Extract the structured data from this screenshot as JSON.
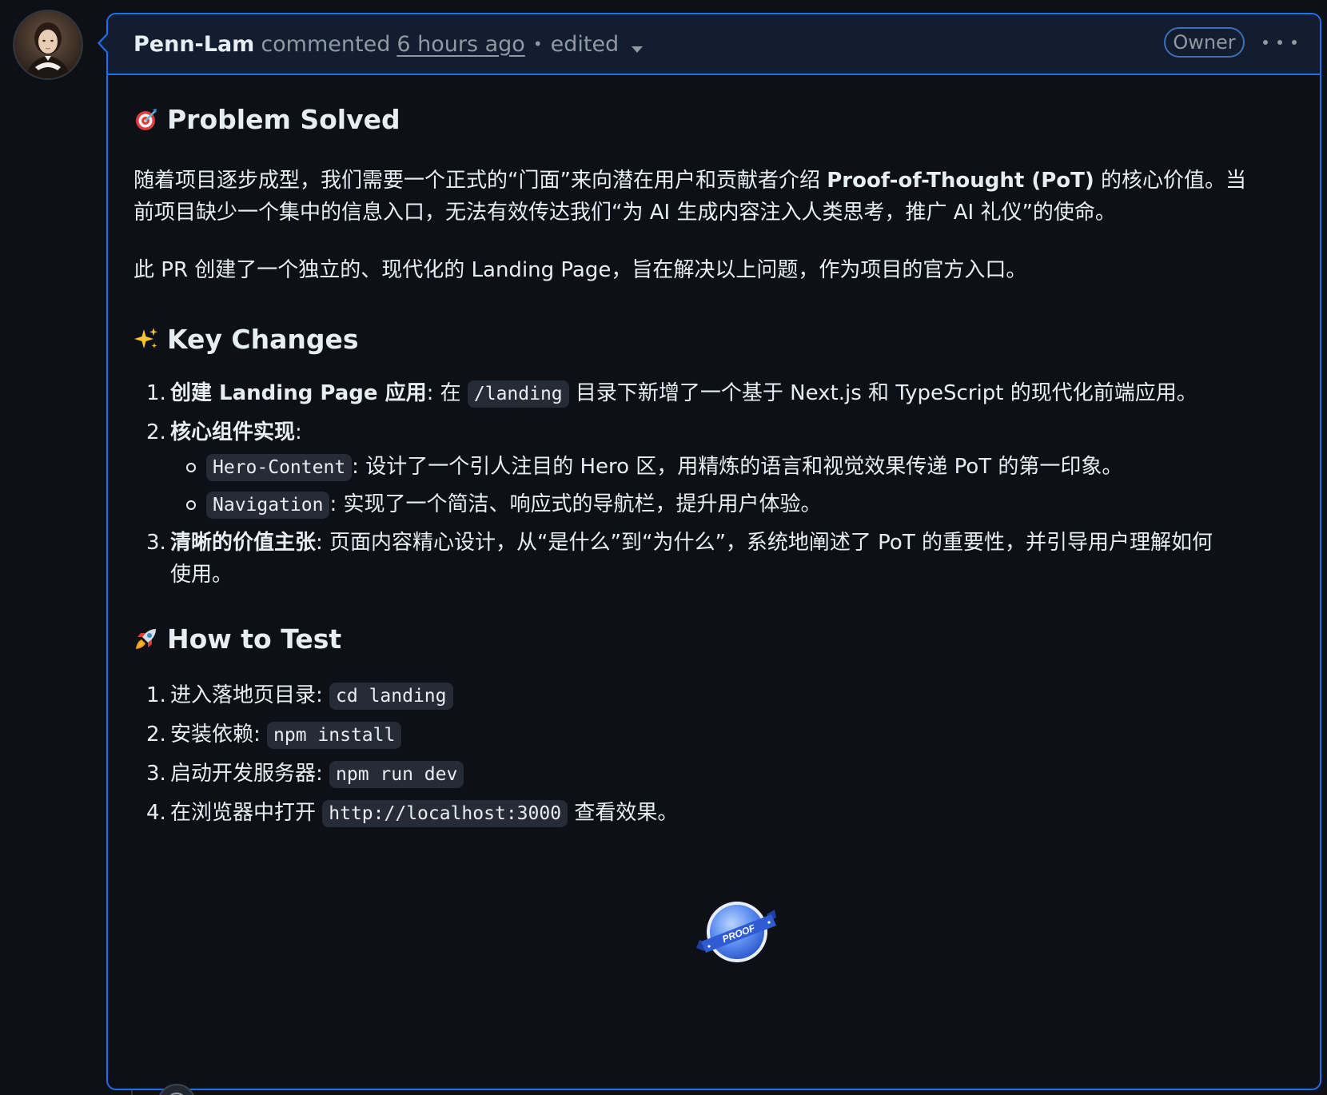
{
  "comment": {
    "author": "Penn-Lam",
    "action": "commented",
    "time": "6 hours ago",
    "separator": "•",
    "edited": "edited",
    "badge": "Owner"
  },
  "sections": {
    "problem": {
      "emoji": "target-emoji",
      "title": "Problem Solved",
      "para1_line1_a": "随着项目逐步成型，我们需要一个正式的“门面”来向潜在用户和贡献者介绍 ",
      "para1_line1_bold": "Proof-of-Thought (PoT)",
      "para1_line1_b": " 的核心价值。当",
      "para1_line2": "前项目缺少一个集中的信息入口，无法有效传达我们“为 AI 生成内容注入人类思考，推广 AI 礼仪”的使命。",
      "para2": "此 PR 创建了一个独立的、现代化的 Landing Page，旨在解决以上问题，作为项目的官方入口。"
    },
    "changes": {
      "emoji": "sparkles-emoji",
      "title": "Key Changes",
      "items": [
        {
          "num": "1.",
          "bold": "创建 Landing Page 应用",
          "text_a": ": 在 ",
          "code": "/landing",
          "text_b": " 目录下新增了一个基于 Next.js 和 TypeScript 的现代化前端应用。"
        },
        {
          "num": "2.",
          "bold": "核心组件实现",
          "text_a": ":",
          "sub": [
            {
              "code": "Hero-Content",
              "text": ": 设计了一个引人注目的 Hero 区，用精炼的语言和视觉效果传递 PoT 的第一印象。"
            },
            {
              "code": "Navigation",
              "text": ": 实现了一个简洁、响应式的导航栏，提升用户体验。"
            }
          ]
        },
        {
          "num": "3.",
          "bold": "清晰的价值主张",
          "text_line1": ": 页面内容精心设计，从“是什么”到“为什么”，系统地阐述了 PoT 的重要性，并引导用户理解如何",
          "text_line2": "使用。"
        }
      ]
    },
    "test": {
      "emoji": "rocket-emoji",
      "title": "How to Test",
      "items": [
        {
          "num": "1.",
          "text": "进入落地页目录: ",
          "code": "cd landing",
          "after": ""
        },
        {
          "num": "2.",
          "text": "安装依赖: ",
          "code": "npm install",
          "after": ""
        },
        {
          "num": "3.",
          "text": "启动开发服务器: ",
          "code": "npm run dev",
          "after": ""
        },
        {
          "num": "4.",
          "text": "在浏览器中打开 ",
          "code": "http://localhost:3000",
          "after": " 查看效果。"
        }
      ]
    }
  },
  "proof_badge": {
    "label": "PROOF",
    "colors": {
      "ribbon": "#2f5bd3",
      "disc": "#5b8def"
    }
  },
  "colors": {
    "background": "#0d1117",
    "header_bg": "#121d2f",
    "accent_border": "#1f6feb",
    "muted_text": "#9198a1",
    "code_bg": "#262c36"
  }
}
